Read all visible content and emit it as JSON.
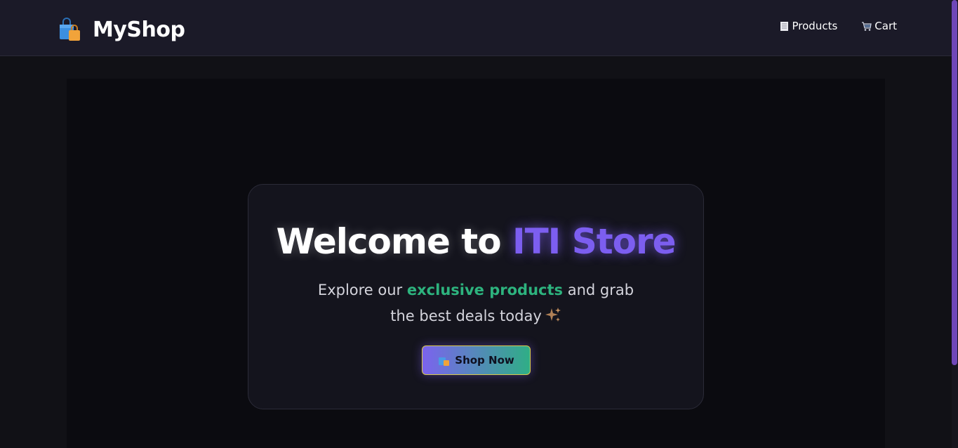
{
  "navbar": {
    "brand_icon": "shopping-bags-icon",
    "brand_name": "MyShop",
    "links": [
      {
        "icon": "receipt-icon",
        "label": "Products"
      },
      {
        "icon": "shopping-cart-icon",
        "label": "Cart"
      }
    ]
  },
  "hero": {
    "title_prefix": "Welcome to",
    "title_accent": "ITI Store",
    "subtitle_before": "Explore our",
    "subtitle_highlight": "exclusive products",
    "subtitle_after": "and grab",
    "subtitle_line2": "the best deals today",
    "subtitle_emoji": "sparkles-icon",
    "button": {
      "icon": "shopping-bags-icon",
      "label": "Shop Now"
    }
  },
  "colors": {
    "navbar_bg": "#1b1a28",
    "page_bg": "#111116",
    "accent_purple": "#7c5ef0",
    "accent_green": "#2db37e",
    "button_border": "#d8c94a",
    "scroll_thumb": "#6f47b8"
  }
}
